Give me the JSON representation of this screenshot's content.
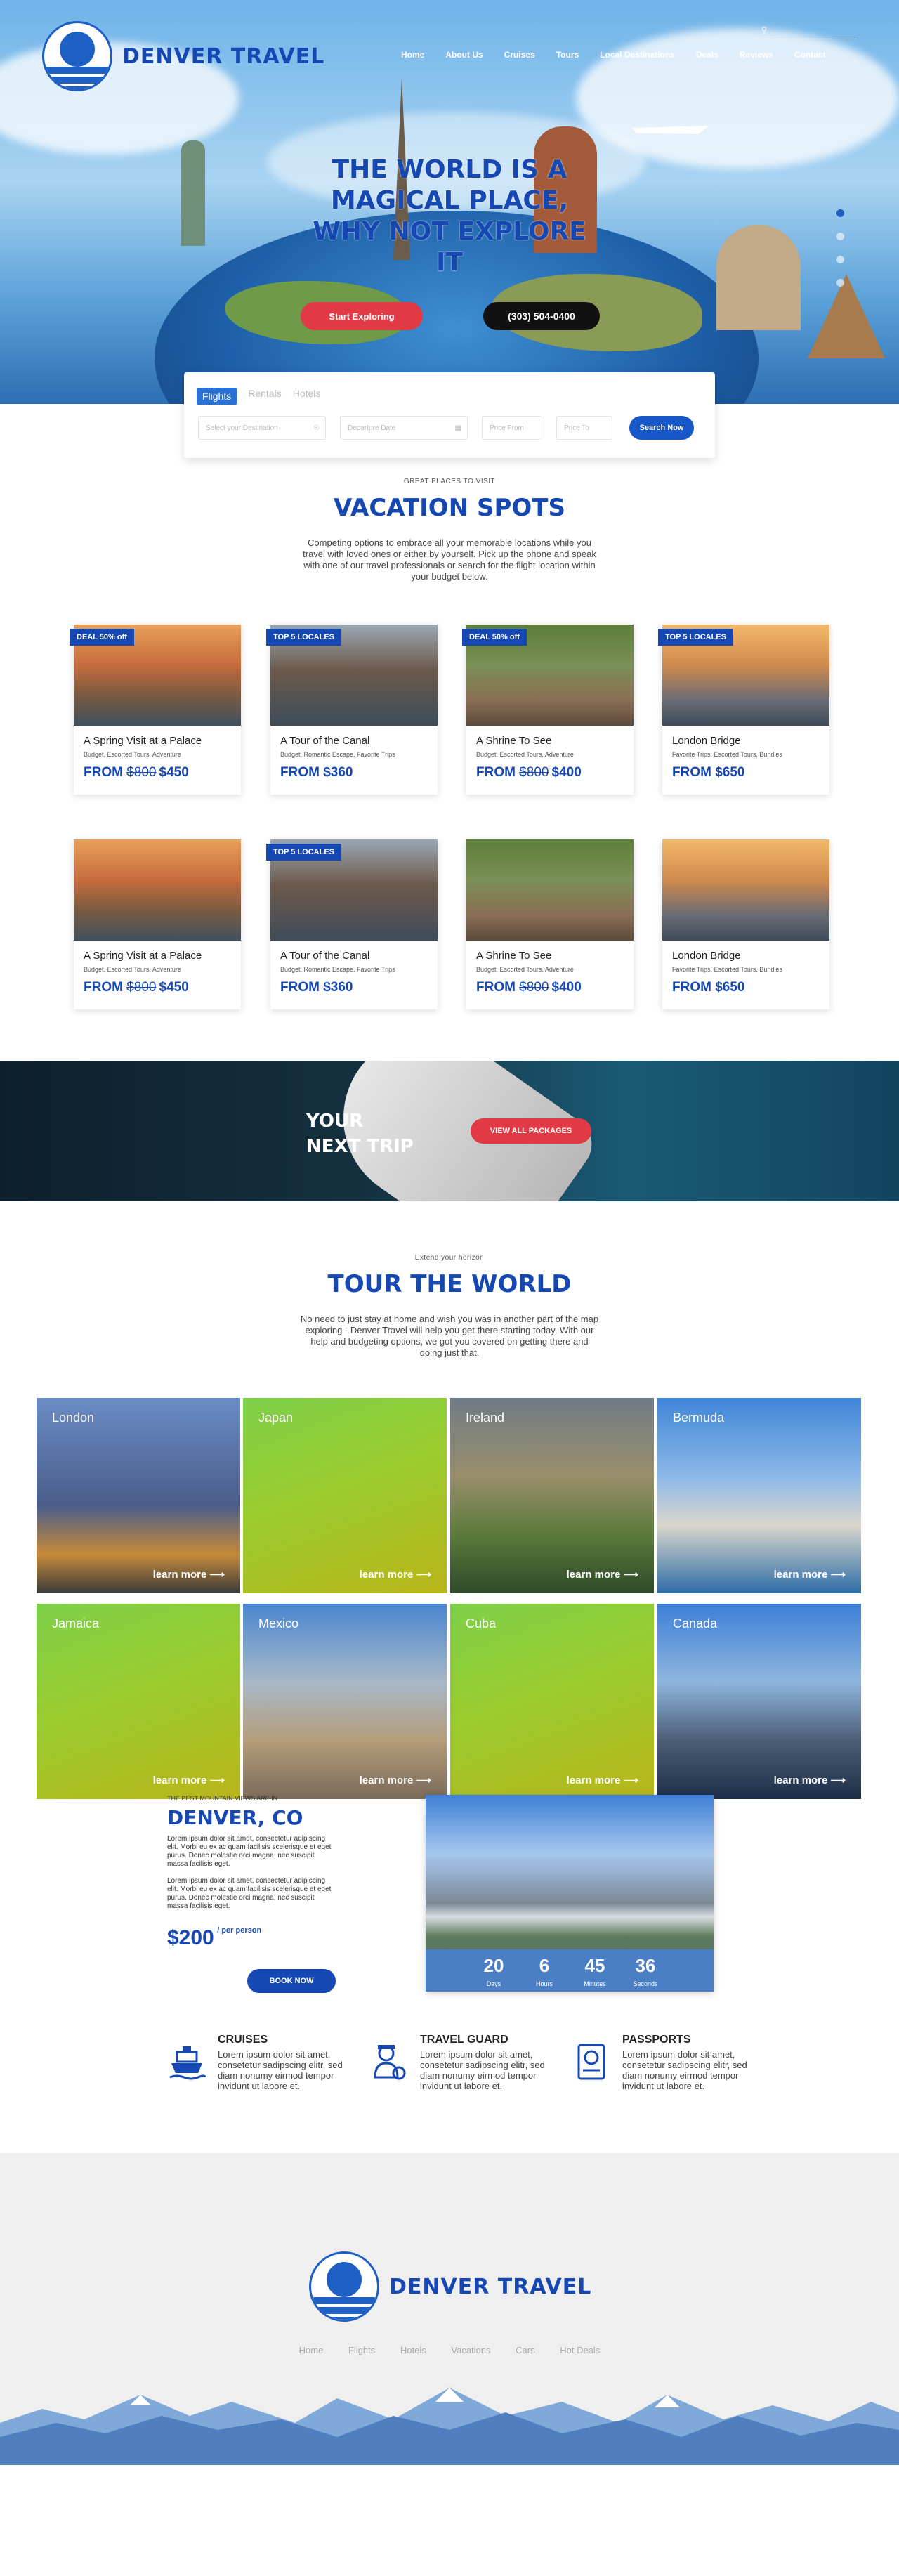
{
  "brand": {
    "name": "DENVER TRAVEL"
  },
  "nav": [
    "Home",
    "About Us",
    "Cruises",
    "Tours",
    "Local Destinations",
    "Deals",
    "Reviews",
    "Contact"
  ],
  "hero": {
    "title": "THE WORLD IS A MAGICAL PLACE, WHY NOT EXPLORE IT",
    "explore_btn": "Start Exploring",
    "phone": "(303) 504-0400",
    "slides": 4,
    "active_slide": 1
  },
  "booking": {
    "tabs": [
      "Flights",
      "Rentals",
      "Hotels"
    ],
    "active_tab": "Flights",
    "destination_placeholder": "Select your Destination",
    "departure_placeholder": "Departure Date",
    "from_placeholder": "Price From",
    "to_placeholder": "Price To",
    "search_btn": "Search Now"
  },
  "vacation": {
    "kicker": "GREAT PLACES TO VISIT",
    "title": "VACATION SPOTS",
    "text": "Competing options to embrace all your memorable locations while you travel with loved ones or either by yourself. Pick up the phone and speak with one of our travel professionals or search for the flight location within your budget below.",
    "cards": [
      {
        "badge": "DEAL 50% off",
        "title": "A Spring Visit at a Palace",
        "tags": "Budget, Escorted Tours, Adventure",
        "from": "FROM",
        "old": "$800",
        "price": "$450"
      },
      {
        "badge": "TOP 5 LOCALES",
        "title": "A Tour of the Canal",
        "tags": "Budget, Romantic Escape, Favorite Trips",
        "from": "FROM",
        "old": "",
        "price": "$360"
      },
      {
        "badge": "DEAL 50% off",
        "title": "A Shrine To See",
        "tags": "Budget, Escorted Tours, Adventure",
        "from": "FROM",
        "old": "$800",
        "price": "$400"
      },
      {
        "badge": "TOP 5 LOCALES",
        "title": "London Bridge",
        "tags": "Favorite Trips, Escorted Tours, Bundles",
        "from": "FROM",
        "old": "",
        "price": "$650"
      },
      {
        "badge": "",
        "title": "A Spring Visit at a Palace",
        "tags": "Budget, Escorted Tours, Adventure",
        "from": "FROM",
        "old": "$800",
        "price": "$450"
      },
      {
        "badge": "TOP 5 LOCALES",
        "title": "A Tour of the Canal",
        "tags": "Budget, Romantic Escape, Favorite Trips",
        "from": "FROM",
        "old": "",
        "price": "$360"
      },
      {
        "badge": "",
        "title": "A Shrine To See",
        "tags": "Budget, Escorted Tours, Adventure",
        "from": "FROM",
        "old": "$800",
        "price": "$400"
      },
      {
        "badge": "",
        "title": "London Bridge",
        "tags": "Favorite Trips, Escorted Tours, Bundles",
        "from": "FROM",
        "old": "",
        "price": "$650"
      }
    ]
  },
  "trip": {
    "title_line1": "YOUR",
    "title_line2": "NEXT TRIP",
    "btn": "VIEW ALL PACKAGES"
  },
  "world": {
    "kicker": "Extend your horizon",
    "title": "TOUR THE WORLD",
    "text": "No need to just stay at home and wish you was in another part of the map exploring - Denver Travel will help you get there starting today. With our help and budgeting options, we got you covered on getting there and doing just that.",
    "more": "learn more",
    "tiles": [
      {
        "name": "London",
        "style": "photo"
      },
      {
        "name": "Japan",
        "style": "green"
      },
      {
        "name": "Ireland",
        "style": "photo"
      },
      {
        "name": "Bermuda",
        "style": "photo"
      },
      {
        "name": "Jamaica",
        "style": "green"
      },
      {
        "name": "Mexico",
        "style": "photo"
      },
      {
        "name": "Cuba",
        "style": "green"
      },
      {
        "name": "Canada",
        "style": "photo"
      }
    ]
  },
  "denver": {
    "kicker": "THE BEST MOUNTAIN VIEWS ARE IN",
    "title": "DENVER, CO",
    "p1": "Lorem ipsum dolor sit amet, consectetur adipiscing elit. Morbi eu ex ac quam facilisis scelerisque et eget purus. Donec molestie orci magna, nec suscipit massa facilisis eget.",
    "p2": "Lorem ipsum dolor sit amet, consectetur adipiscing elit. Morbi eu ex ac quam facilisis scelerisque et eget purus. Donec molestie orci magna, nec suscipit massa facilisis eget.",
    "price": "$200",
    "per": "/ per person",
    "btn": "BOOK NOW",
    "countdown": [
      {
        "value": "20",
        "label": "Days"
      },
      {
        "value": "6",
        "label": "Hours"
      },
      {
        "value": "45",
        "label": "Minutes"
      },
      {
        "value": "36",
        "label": "Seconds"
      }
    ]
  },
  "features": [
    {
      "title": "CRUISES",
      "text": "Lorem ipsum dolor sit amet, consetetur sadipscing elitr, sed diam nonumy eirmod tempor invidunt ut labore et.",
      "icon": "ship-icon"
    },
    {
      "title": "TRAVEL GUARD",
      "text": "Lorem ipsum dolor sit amet, consetetur sadipscing elitr, sed diam nonumy eirmod tempor invidunt ut labore et.",
      "icon": "guard-icon"
    },
    {
      "title": "PASSPORTS",
      "text": "Lorem ipsum dolor sit amet, consetetur sadipscing elitr, sed diam nonumy eirmod tempor invidunt ut labore et.",
      "icon": "passport-icon"
    }
  ],
  "footer": {
    "links": [
      "Home",
      "Flights",
      "Hotels",
      "Vacations",
      "Cars",
      "Hot Deals"
    ]
  },
  "colors": {
    "brand": "#1648b4",
    "accent": "#e23a45",
    "button": "#1857c8"
  }
}
